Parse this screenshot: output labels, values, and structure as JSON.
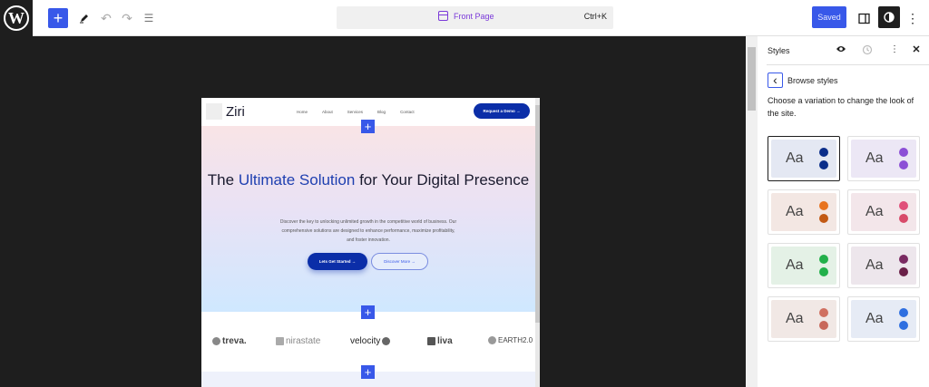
{
  "toolbar": {
    "logo_letter": "W",
    "add_icon": "+",
    "tools_icon": "pen-icon",
    "undo_icon": "↶",
    "redo_icon": "↷",
    "list_icon": "☰",
    "command_title": "Front Page",
    "shortcut": "Ctrl+K",
    "saved_label": "Saved",
    "more_icon": "⋮"
  },
  "site": {
    "logo": "Ziri",
    "nav": [
      "Home",
      "About",
      "Services",
      "Blog",
      "Contact"
    ],
    "header_button": "Request a Demo →",
    "headline_pre": "The ",
    "headline_accent": "Ultimate Solution",
    "headline_post": " for Your Digital Presence",
    "description": "Discover the key to unlocking unlimited growth in the competitive world of business. Our comprehensive solutions are designed to enhance performance, maximize profitability, and foster innovation.",
    "cta_primary": "Lets Get Started →",
    "cta_secondary": "Discover More →",
    "inserter_icon": "+",
    "logos": [
      "treva.",
      "nirastate",
      "velocity",
      "liva",
      "EARTH2.0"
    ]
  },
  "panel": {
    "title": "Styles",
    "back_icon": "‹",
    "browse_label": "Browse styles",
    "description": "Choose a variation to change the look of the site.",
    "variation_text": "Aa",
    "variations": [
      {
        "bg": "#e4e8f3",
        "c1": "#0b2e8a",
        "c2": "#0b2e8a",
        "selected": true
      },
      {
        "bg": "#ece7f5",
        "c1": "#8c4fd6",
        "c2": "#8c4fd6",
        "selected": false
      },
      {
        "bg": "#f3e7e3",
        "c1": "#e8741f",
        "c2": "#c25a14",
        "selected": false
      },
      {
        "bg": "#f3e6ea",
        "c1": "#e0507a",
        "c2": "#d84b6a",
        "selected": false
      },
      {
        "bg": "#e4f1e6",
        "c1": "#22b04a",
        "c2": "#22b04a",
        "selected": false
      },
      {
        "bg": "#ede6ec",
        "c1": "#7a2a62",
        "c2": "#6a2048",
        "selected": false
      },
      {
        "bg": "#f1e8e5",
        "c1": "#d07060",
        "c2": "#c8685a",
        "selected": false
      },
      {
        "bg": "#e6ebf5",
        "c1": "#2f6fe0",
        "c2": "#2f6fe0",
        "selected": false
      }
    ]
  }
}
